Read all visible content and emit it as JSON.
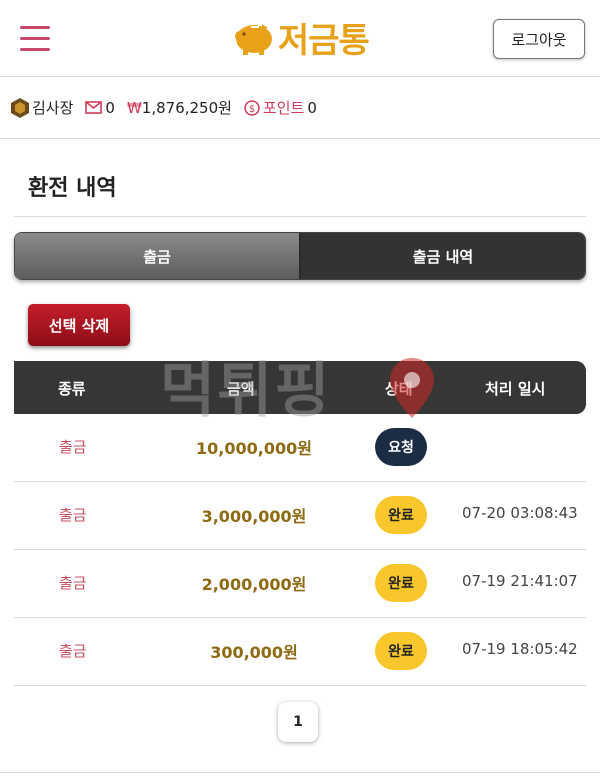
{
  "header": {
    "logo_text": "저금통",
    "logout_label": "로그아웃"
  },
  "user": {
    "name": "김사장",
    "messages": "0",
    "money_symbol": "₩",
    "money": "1,876,250원",
    "point_label": "포인트",
    "point": "0"
  },
  "page": {
    "title": "환전 내역"
  },
  "tabs": [
    {
      "label": "출금"
    },
    {
      "label": "출금 내역"
    }
  ],
  "delete_label": "선택 삭제",
  "table": {
    "headers": [
      "종류",
      "금액",
      "상태",
      "처리 일시"
    ],
    "rows": [
      {
        "type": "출금",
        "amount": "10,000,000원",
        "status": "요청",
        "time": ""
      },
      {
        "type": "출금",
        "amount": "3,000,000원",
        "status": "완료",
        "time": "07-20 03:08:43"
      },
      {
        "type": "출금",
        "amount": "2,000,000원",
        "status": "완료",
        "time": "07-19 21:41:07"
      },
      {
        "type": "출금",
        "amount": "300,000원",
        "status": "완료",
        "time": "07-19 18:05:42"
      }
    ]
  },
  "pagination": {
    "current": "1"
  },
  "watermark": "먹튀핑",
  "colors": {
    "accent_pink": "#c9486b",
    "logo_gold": "#e8a21a",
    "status_request": "#1b2d44",
    "status_done": "#f9c62c",
    "delete_red": "#b0141f"
  }
}
